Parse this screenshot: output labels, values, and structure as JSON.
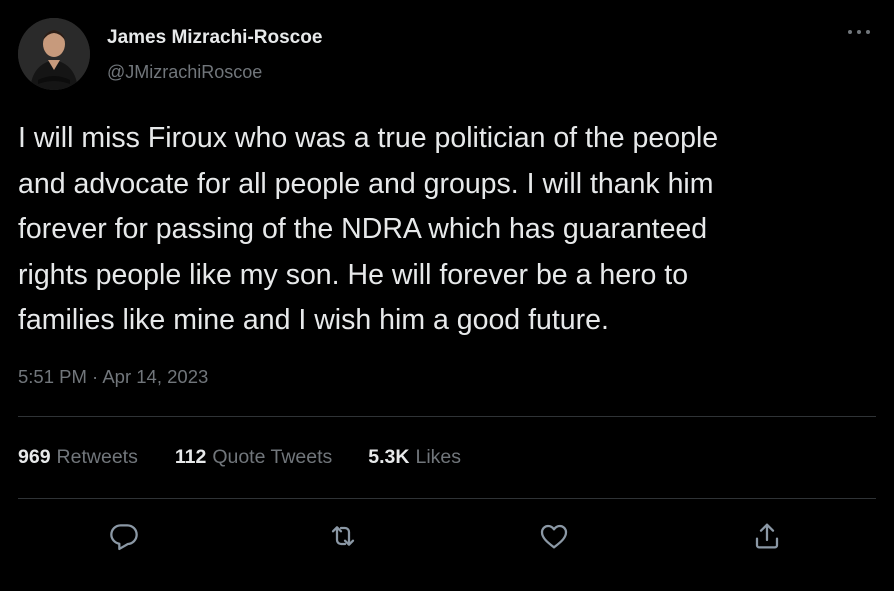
{
  "author": {
    "display_name": "James Mizrachi-Roscoe",
    "handle": "@JMizrachiRoscoe"
  },
  "tweet": {
    "text": "I will miss Firoux who was a true politician of the people\nand advocate for all people and groups. I will thank him\nforever for passing of the NDRA which has guaranteed\nrights people like my son. He will forever be a hero to\nfamilies like mine and I wish him a good future.",
    "time": "5:51 PM",
    "separator": "·",
    "date": "Apr 14, 2023"
  },
  "stats": {
    "retweets": {
      "count": "969",
      "label": "Retweets"
    },
    "quote_tweets": {
      "count": "112",
      "label": "Quote Tweets"
    },
    "likes": {
      "count": "5.3K",
      "label": "Likes"
    }
  },
  "actions": {
    "reply_icon": "reply-icon",
    "retweet_icon": "retweet-icon",
    "like_icon": "heart-icon",
    "share_icon": "share-icon"
  },
  "colors": {
    "background": "#000000",
    "primary_text": "#e7e9ea",
    "secondary_text": "#71767b",
    "divider": "#2f3336"
  }
}
